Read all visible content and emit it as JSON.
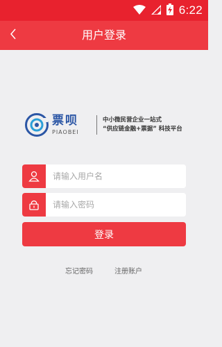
{
  "status_bar": {
    "time": "6:22",
    "icons": [
      "wifi-icon",
      "signal-icon",
      "battery-charging-icon"
    ]
  },
  "nav": {
    "title": "用户登录",
    "back_icon": "chevron-left-icon"
  },
  "brand": {
    "logo_cn": "票呗",
    "logo_en": "PIAOBEI",
    "slogan_line1": "中小微民营企业一站式",
    "slogan_line2": "“供应链金融+票据” 科技平台"
  },
  "form": {
    "username": {
      "value": "",
      "placeholder": "请输入用户名",
      "icon": "user-icon"
    },
    "password": {
      "value": "",
      "placeholder": "请输入密码",
      "icon": "lock-icon"
    },
    "login_label": "登录"
  },
  "links": {
    "forgot_password": "忘记密码",
    "register": "注册账户"
  },
  "colors": {
    "status_bar": "#e8222e",
    "accent": "#ee3a42",
    "background": "#efeff1",
    "brand_blue": "#2b56a5"
  }
}
